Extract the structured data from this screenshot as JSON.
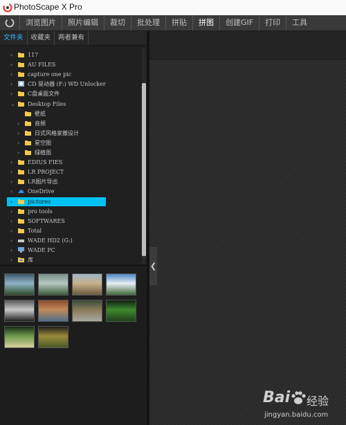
{
  "window": {
    "title": "PhotoScape X Pro"
  },
  "nav": {
    "tabs": [
      {
        "label": "浏览图片",
        "active": false
      },
      {
        "label": "照片编辑",
        "active": false
      },
      {
        "label": "裁切",
        "active": false
      },
      {
        "label": "批处理",
        "active": false
      },
      {
        "label": "拼贴",
        "active": false
      },
      {
        "label": "拼图",
        "active": true
      },
      {
        "label": "创建GIF",
        "active": false
      },
      {
        "label": "打印",
        "active": false
      },
      {
        "label": "工具",
        "active": false
      }
    ]
  },
  "sidebar": {
    "tabs": [
      {
        "label": "文件夹",
        "active": true
      },
      {
        "label": "收藏夹",
        "active": false
      },
      {
        "label": "两者兼有",
        "active": false
      }
    ],
    "tree": [
      {
        "label": "117",
        "icon": "folder",
        "level": 0,
        "expanded": false
      },
      {
        "label": "AU FILES",
        "icon": "folder",
        "level": 0,
        "expanded": false
      },
      {
        "label": "capture one pic",
        "icon": "folder",
        "level": 0,
        "expanded": false
      },
      {
        "label": "CD 驱动器 (F:) WD Unlocker",
        "icon": "cd-drive",
        "level": 0,
        "expanded": false
      },
      {
        "label": "C盘桌面文件",
        "icon": "folder",
        "level": 0,
        "expanded": false
      },
      {
        "label": "Desktop Files",
        "icon": "folder",
        "level": 0,
        "expanded": true
      },
      {
        "label": "壁纸",
        "icon": "folder",
        "level": 1,
        "expanded": false,
        "leaf": true
      },
      {
        "label": "音频",
        "icon": "folder",
        "level": 1,
        "expanded": false
      },
      {
        "label": "日式风格家撤设计",
        "icon": "folder",
        "level": 1,
        "expanded": false
      },
      {
        "label": "星空图",
        "icon": "folder",
        "level": 1,
        "expanded": false
      },
      {
        "label": "绿植图",
        "icon": "folder",
        "level": 1,
        "expanded": false
      },
      {
        "label": "EDIUS FIES",
        "icon": "folder",
        "level": 0,
        "expanded": false
      },
      {
        "label": "LR PROJECT",
        "icon": "folder",
        "level": 0,
        "expanded": false
      },
      {
        "label": "LR图片导出",
        "icon": "folder",
        "level": 0,
        "expanded": false
      },
      {
        "label": "OneDrive",
        "icon": "cloud",
        "level": 0,
        "expanded": false
      },
      {
        "label": "pictures",
        "icon": "folder",
        "level": 0,
        "expanded": false,
        "selected": true
      },
      {
        "label": "pro tools",
        "icon": "folder",
        "level": 0,
        "expanded": false
      },
      {
        "label": "SOFTWARES",
        "icon": "folder",
        "level": 0,
        "expanded": false
      },
      {
        "label": "Total",
        "icon": "folder",
        "level": 0,
        "expanded": false
      },
      {
        "label": "WADE HD2 (G:)",
        "icon": "drive",
        "level": 0,
        "expanded": false
      },
      {
        "label": "WADE PC",
        "icon": "pc",
        "level": 0,
        "expanded": false
      },
      {
        "label": "库",
        "icon": "library",
        "level": 0,
        "expanded": false
      }
    ]
  },
  "thumbnails": [
    {
      "name": "thumb-landscape-1",
      "colors": [
        "#3f5a6f",
        "#8fb3c6",
        "#2e4a2a"
      ]
    },
    {
      "name": "thumb-landscape-2",
      "colors": [
        "#7a8f8a",
        "#b5c7c0",
        "#3d5a3a"
      ]
    },
    {
      "name": "thumb-landscape-3",
      "colors": [
        "#9fb6c9",
        "#c7b08a",
        "#6a5a40"
      ]
    },
    {
      "name": "thumb-landscape-4",
      "colors": [
        "#4f86c6",
        "#e8eef4",
        "#3f6a3a"
      ]
    },
    {
      "name": "thumb-landscape-5",
      "colors": [
        "#5a5a5a",
        "#c9c9c9",
        "#202020"
      ]
    },
    {
      "name": "thumb-landscape-6",
      "colors": [
        "#8a4a2f",
        "#c28a5a",
        "#4f6f8a"
      ]
    },
    {
      "name": "thumb-landscape-7",
      "colors": [
        "#3a4a3a",
        "#8a7a5a",
        "#a8a8a0"
      ]
    },
    {
      "name": "thumb-landscape-8",
      "colors": [
        "#0f1f0f",
        "#3f8a2f",
        "#1f3f1a"
      ]
    },
    {
      "name": "thumb-landscape-9",
      "colors": [
        "#1a2a1a",
        "#6f9a4a",
        "#d8d0a0"
      ]
    },
    {
      "name": "thumb-landscape-10",
      "colors": [
        "#1f1f1a",
        "#9a8a3a",
        "#4a5a2a"
      ]
    }
  ],
  "watermark": {
    "brand": "Bai",
    "brand_cn": "经验",
    "url": "jingyan.baidu.com"
  },
  "colors": {
    "accent": "#38b8ff",
    "selected_row": "#00c2f2",
    "folder": "#f4c94a"
  }
}
